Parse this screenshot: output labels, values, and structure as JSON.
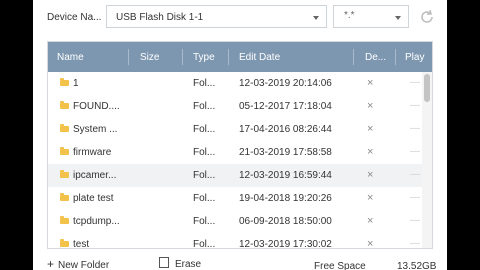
{
  "device": {
    "label": "Device Na...",
    "selected": "USB Flash Disk 1-1",
    "filter_value": "*.*"
  },
  "table": {
    "columns": [
      "Name",
      "Size",
      "Type",
      "Edit Date",
      "De...",
      "Play"
    ],
    "rows": [
      {
        "name": "1",
        "size": "",
        "type": "Fol...",
        "date": "12-03-2019 20:14:06",
        "delete": "×",
        "play": "—",
        "selected": false
      },
      {
        "name": "FOUND....",
        "size": "",
        "type": "Fol...",
        "date": "05-12-2017 17:18:04",
        "delete": "×",
        "play": "—",
        "selected": false
      },
      {
        "name": "System ...",
        "size": "",
        "type": "Fol...",
        "date": "17-04-2016 08:26:44",
        "delete": "×",
        "play": "—",
        "selected": false
      },
      {
        "name": "firmware",
        "size": "",
        "type": "Fol...",
        "date": "21-03-2019 17:58:58",
        "delete": "×",
        "play": "—",
        "selected": false
      },
      {
        "name": "ipcamer...",
        "size": "",
        "type": "Fol...",
        "date": "12-03-2019 16:59:44",
        "delete": "×",
        "play": "—",
        "selected": true
      },
      {
        "name": "plate test",
        "size": "",
        "type": "Fol...",
        "date": "19-04-2018 19:20:26",
        "delete": "×",
        "play": "—",
        "selected": false
      },
      {
        "name": "tcpdump...",
        "size": "",
        "type": "Fol...",
        "date": "06-09-2018 18:50:00",
        "delete": "×",
        "play": "—",
        "selected": false
      },
      {
        "name": "test",
        "size": "",
        "type": "Fol...",
        "date": "12-03-2019 17:30:02",
        "delete": "×",
        "play": "—",
        "selected": false
      }
    ]
  },
  "footer": {
    "new_folder": "New Folder",
    "erase": "Erase",
    "free_space_label": "Free Space",
    "free_space_value": "13.52GB"
  },
  "colors": {
    "header_bg": "#7e97b1",
    "folder": "#f3c24a",
    "selected_row": "#f1f2f4"
  }
}
